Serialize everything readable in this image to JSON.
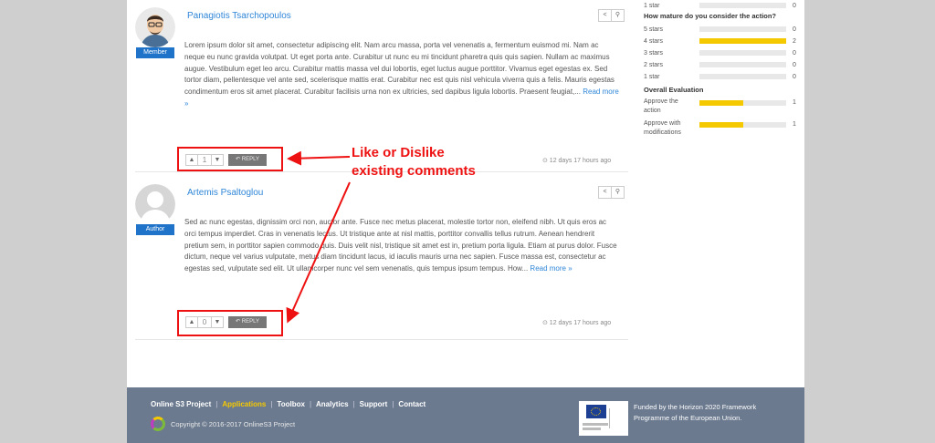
{
  "comments": [
    {
      "author": "Panagiotis Tsarchopoulos",
      "role": "Member",
      "body": "Lorem ipsum dolor sit amet, consectetur adipiscing elit. Nam arcu massa, porta vel venenatis a, fermentum euismod mi. Nam ac neque eu nunc gravida volutpat. Ut eget porta ante. Curabitur ut nunc eu mi tincidunt pharetra quis quis sapien. Nullam ac maximus augue. Vestibulum eget leo arcu. Curabitur mattis massa vel dui lobortis, eget luctus augue porttitor. Vivamus eget egestas ex. Sed tortor diam, pellentesque vel ante sed, scelerisque mattis erat. Curabitur nec est quis nisl vehicula viverra quis a felis. Mauris egestas condimentum eros sit amet placerat. Curabitur facilisis urna non ex ultricies, sed dapibus ligula lobortis. Praesent feugiat,...",
      "read_more": "Read more »",
      "votes": "1",
      "reply": "REPLY",
      "timestamp": "⊙ 12 days 17 hours ago"
    },
    {
      "author": "Artemis Psaltoglou",
      "role": "Author",
      "body": "Sed ac nunc egestas, dignissim orci non, auctor ante. Fusce nec metus placerat, molestie tortor non, eleifend nibh. Ut quis eros ac orci tempus imperdiet. Cras in venenatis lectus. Ut tristique ante at nisl mattis, porttitor convallis tellus rutrum. Aenean hendrerit pretium sem, in porttitor sapien commodo quis. Duis velit nisl, tristique sit amet est in, pretium porta ligula. Etiam at purus dolor. Fusce dictum, neque vel varius vulputate, metus diam tincidunt lacus, id iaculis mauris urna nec sapien. Fusce massa est, consectetur ac egestas sed, vulputate sed elit. Ut ullamcorper nunc vel sem venenatis, quis tempus ipsum tempus. How...",
      "read_more": "Read more »",
      "votes": "0",
      "reply": "REPLY",
      "timestamp": "⊙ 12 days 17 hours ago"
    }
  ],
  "annotation": {
    "line1": "Like or Dislike",
    "line2": "existing comments"
  },
  "sidebar": {
    "top_row": {
      "label": "1 star",
      "value": 0
    },
    "maturity_title": "How mature do you consider the action?",
    "maturity": [
      {
        "label": "5 stars",
        "value": 0,
        "fill": 0
      },
      {
        "label": "4 stars",
        "value": 2,
        "fill": 1
      },
      {
        "label": "3 stars",
        "value": 0,
        "fill": 0
      },
      {
        "label": "2 stars",
        "value": 0,
        "fill": 0
      },
      {
        "label": "1 star",
        "value": 0,
        "fill": 0
      }
    ],
    "eval_title": "Overall Evaluation",
    "evaluation": [
      {
        "label": "Approve the action",
        "value": 1,
        "fill": 0.5
      },
      {
        "label": "Approve with modifications",
        "value": 1,
        "fill": 0.5
      }
    ]
  },
  "footer": {
    "links": [
      "Online S3 Project",
      "Applications",
      "Toolbox",
      "Analytics",
      "Support",
      "Contact"
    ],
    "active_link": "Applications",
    "copyright": "Copyright © 2016-2017 OnlineS3 Project",
    "funded": "Funded by the Horizon 2020 Framework Programme of the European Union."
  },
  "icons": {
    "share": "share-icon",
    "link": "link-icon",
    "like": "thumbs-up-icon",
    "dislike": "thumbs-down-icon",
    "reply": "reply-icon",
    "clock": "clock-icon"
  },
  "colors": {
    "accent": "#2f86d8",
    "highlight": "#e11111",
    "bar": "#f5c900",
    "footer": "#6b7a8f"
  }
}
